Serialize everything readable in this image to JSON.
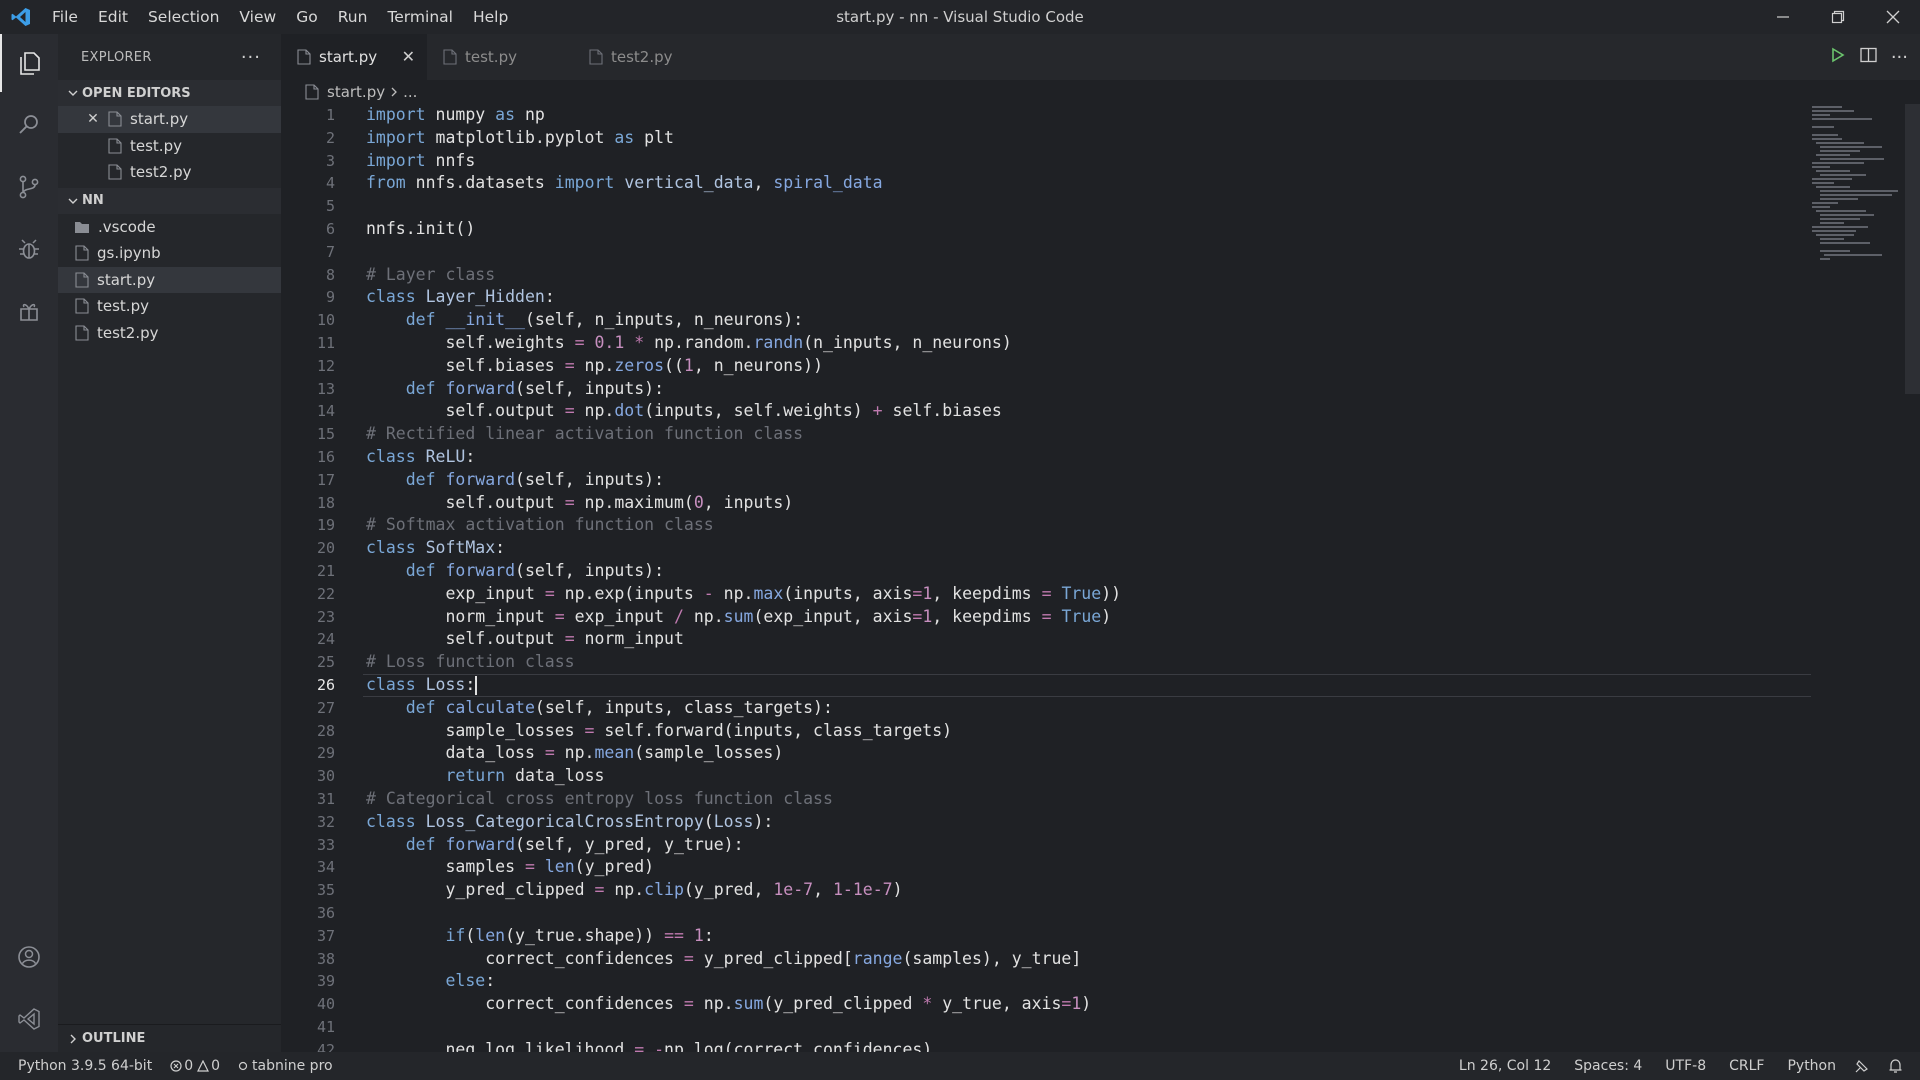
{
  "menu": [
    "File",
    "Edit",
    "Selection",
    "View",
    "Go",
    "Run",
    "Terminal",
    "Help"
  ],
  "window_title": "start.py - nn - Visual Studio Code",
  "explorer": {
    "title": "EXPLORER",
    "open_editors_label": "OPEN EDITORS",
    "open_editors": [
      "start.py",
      "test.py",
      "test2.py"
    ],
    "folder_label": "NN",
    "folder_items": [
      ".vscode",
      "gs.ipynb",
      "start.py",
      "test.py",
      "test2.py"
    ],
    "outline_label": "OUTLINE"
  },
  "tabs": [
    {
      "label": "start.py"
    },
    {
      "label": "test.py"
    },
    {
      "label": "test2.py"
    }
  ],
  "breadcrumb": {
    "file": "start.py",
    "rest": "..."
  },
  "editor": {
    "current_line": 26,
    "visible_lines": 42
  },
  "status": {
    "python_env": "Python 3.9.5 64-bit",
    "errors": "0",
    "warnings": "0",
    "tabnine": "tabnine pro",
    "cursor_pos": "Ln 26, Col 12",
    "spaces": "Spaces: 4",
    "encoding": "UTF-8",
    "eol": "CRLF",
    "language": "Python"
  },
  "colors": {
    "accent": "#3c9ee8",
    "keyword": "#7aa7d6",
    "comment": "#6d7078",
    "number": "#c78fbf",
    "run": "#6bc46d"
  }
}
